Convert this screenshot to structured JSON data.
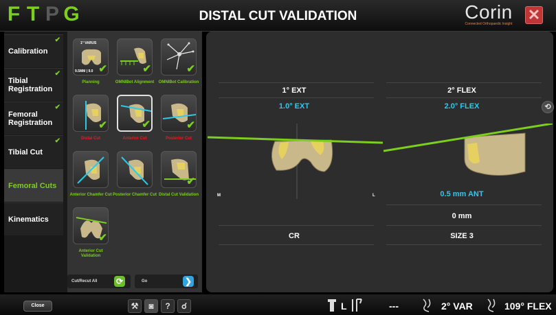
{
  "header": {
    "logo_letters": [
      "F",
      "T",
      "P",
      "G"
    ],
    "title": "DISTAL CUT VALIDATION",
    "brand_name": "Corin",
    "brand_tagline": "Connected Orthopaedic Insight",
    "close_glyph": "✕"
  },
  "colors": {
    "green": "#7ccf1c",
    "cyan": "#2ec9e8",
    "red": "#e02020",
    "close_red": "#c03535",
    "go_blue": "#2ea4e0"
  },
  "nav": {
    "items": [
      {
        "label": "Calibration",
        "done": true,
        "active": false
      },
      {
        "label": "Tibial Registration",
        "done": true,
        "active": false
      },
      {
        "label": "Femoral Registration",
        "done": true,
        "active": false
      },
      {
        "label": "Tibial Cut",
        "done": true,
        "active": false
      },
      {
        "label": "Femoral Cuts",
        "done": false,
        "active": true
      },
      {
        "label": "Kinematics",
        "done": false,
        "active": false
      }
    ],
    "check_glyph": "✔"
  },
  "workflow": {
    "tiles": [
      {
        "label": "Planning",
        "sub_top": "1° VARUS",
        "sub_bottom": "9.5MM | 9.0",
        "done": true,
        "label_color": "green"
      },
      {
        "label": "OMNIBot Alignment",
        "done": true,
        "label_color": "green"
      },
      {
        "label": "OMNIBot Calibration",
        "done": true,
        "label_color": "green"
      },
      {
        "label": "Distal Cut",
        "done": true,
        "label_color": "red"
      },
      {
        "label": "Anterior Cut",
        "done": true,
        "label_color": "red",
        "selected": true
      },
      {
        "label": "Posterior Cut",
        "done": true,
        "label_color": "red"
      },
      {
        "label": "Anterior Chamfer Cut",
        "done": false,
        "label_color": "green"
      },
      {
        "label": "Posterior Chamfer Cut",
        "done": false,
        "label_color": "green"
      },
      {
        "label": "Distal Cut Validation",
        "done": true,
        "label_color": "green"
      },
      {
        "label": "Anterior Cut Validation",
        "done": true,
        "label_color": "green"
      }
    ],
    "recut_label": "Cut/Recut All",
    "recut_glyph": "⟳",
    "go_label": "Go",
    "go_glyph": "❯"
  },
  "main": {
    "left": {
      "planned": "1° EXT",
      "actual": "1.0° EXT",
      "bottom": "CR",
      "medial_marker": "M",
      "lateral_marker": "L"
    },
    "right": {
      "planned": "2° FLEX",
      "actual": "2.0° FLEX",
      "offset": "0.5 mm ANT",
      "depth": "0 mm",
      "size": "SIZE 3"
    },
    "rotate_glyph": "⟲"
  },
  "footer": {
    "close_label": "Close",
    "tools": [
      "⚒",
      "◙",
      "?",
      "☌"
    ],
    "side": "L",
    "gap_value": "---",
    "varus_value": "2° VAR",
    "flex_value": "109° FLEX"
  }
}
